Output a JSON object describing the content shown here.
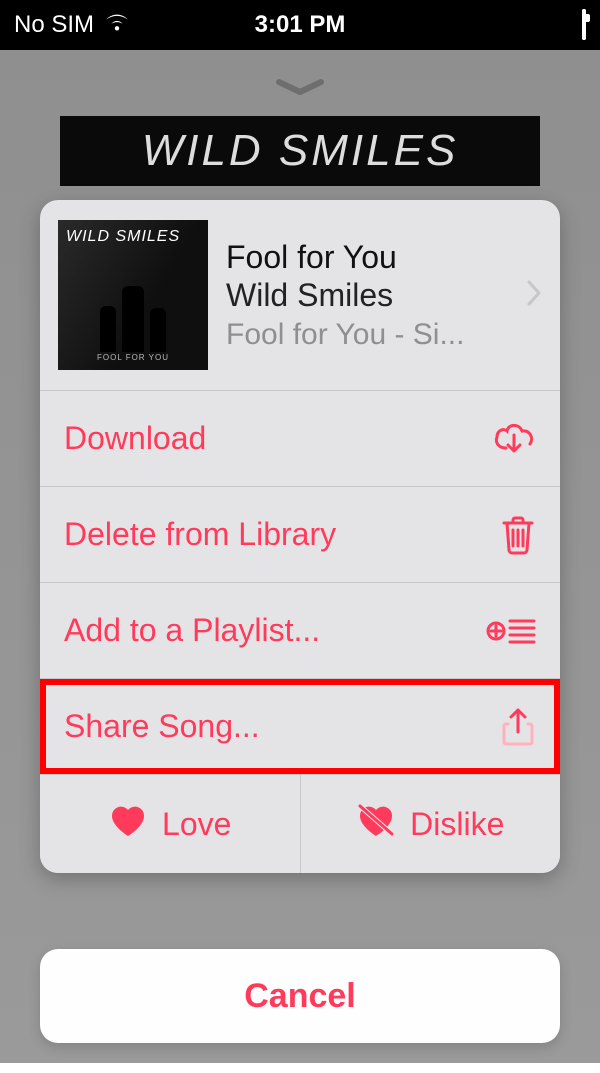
{
  "status": {
    "carrier": "No SIM",
    "time": "3:01 PM"
  },
  "banner": {
    "artist": "WILD SMILES"
  },
  "song": {
    "art_title": "WILD SMILES",
    "art_sub": "FOOL FOR YOU",
    "title": "Fool for You",
    "artist": "Wild Smiles",
    "album_line": "Fool for You - Si..."
  },
  "actions": {
    "download": "Download",
    "delete": "Delete from Library",
    "add_playlist": "Add to a Playlist...",
    "share": "Share Song...",
    "love": "Love",
    "dislike": "Dislike"
  },
  "cancel": "Cancel",
  "colors": {
    "accent": "#ff3a5b"
  }
}
